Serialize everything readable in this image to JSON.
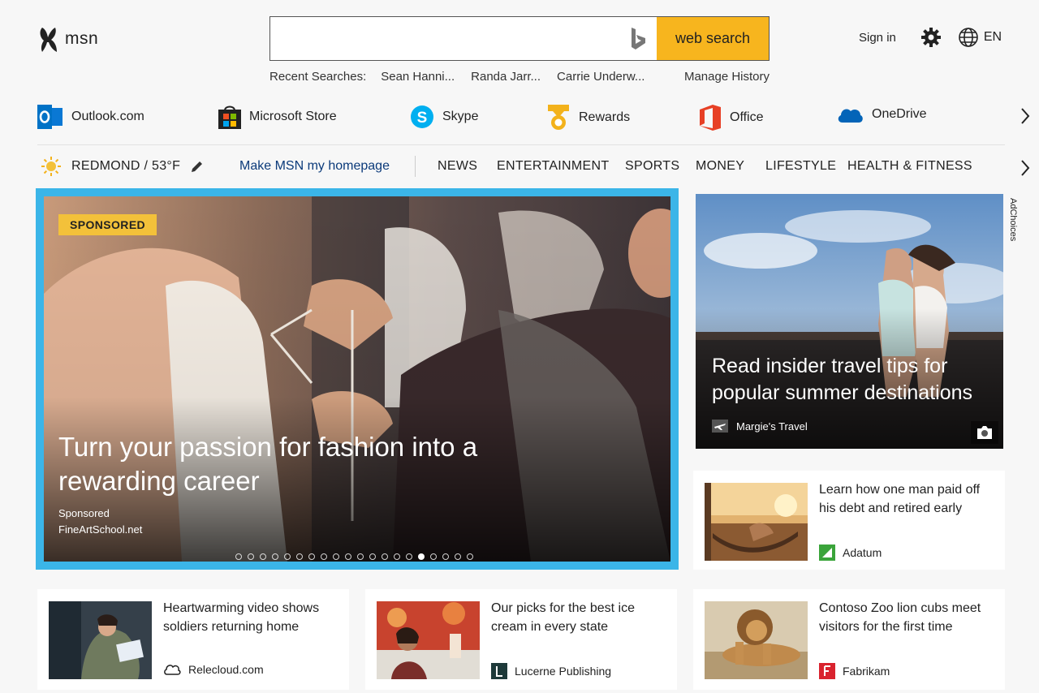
{
  "header": {
    "logo_text": "msn",
    "search": {
      "value": "",
      "button_label": "web search",
      "icon": "bing-icon"
    },
    "recent": {
      "label": "Recent Searches:",
      "items": [
        "Sean Hanni...",
        "Randa Jarr...",
        "Carrie Underw..."
      ],
      "manage_label": "Manage History"
    },
    "sign_in_label": "Sign in",
    "language": "EN"
  },
  "apps": [
    {
      "label": "Outlook.com",
      "icon": "outlook-icon",
      "color": "#0072c6"
    },
    {
      "label": "Microsoft Store",
      "icon": "store-icon",
      "color": "#222222"
    },
    {
      "label": "Skype",
      "icon": "skype-icon",
      "color": "#00aff0"
    },
    {
      "label": "Rewards",
      "icon": "rewards-icon",
      "color": "#f3b21b"
    },
    {
      "label": "Office",
      "icon": "office-icon",
      "color": "#e74025"
    },
    {
      "label": "OneDrive",
      "icon": "onedrive-icon",
      "color": "#0364b8"
    }
  ],
  "navbar": {
    "weather": "REDMOND / 53°F",
    "homepage_link": "Make MSN my homepage",
    "items": [
      "NEWS",
      "ENTERTAINMENT",
      "SPORTS",
      "MONEY",
      "LIFESTYLE",
      "HEALTH & FITNESS"
    ]
  },
  "hero": {
    "badge": "SPONSORED",
    "title": "Turn your passion for fashion into a rewarding career",
    "source_line1": "Sponsored",
    "source_line2": "FineArtSchool.net",
    "slide_count": 20,
    "active_slide": 15,
    "border_color": "#3bb5e8"
  },
  "travel": {
    "title": "Read insider travel tips for popular summer destinations",
    "source": "Margie's Travel"
  },
  "adchoices_label": "AdChoices",
  "cards": {
    "debt": {
      "title": "Learn how one man paid off his debt and retired early",
      "source": "Adatum"
    },
    "soldiers": {
      "title": "Heartwarming video shows soldiers returning home",
      "source": "Relecloud.com"
    },
    "icecream": {
      "title": "Our picks for the best ice cream in every state",
      "source": "Lucerne Publishing"
    },
    "lion": {
      "title": "Contoso Zoo lion cubs meet visitors for the first time",
      "source": "Fabrikam"
    }
  }
}
